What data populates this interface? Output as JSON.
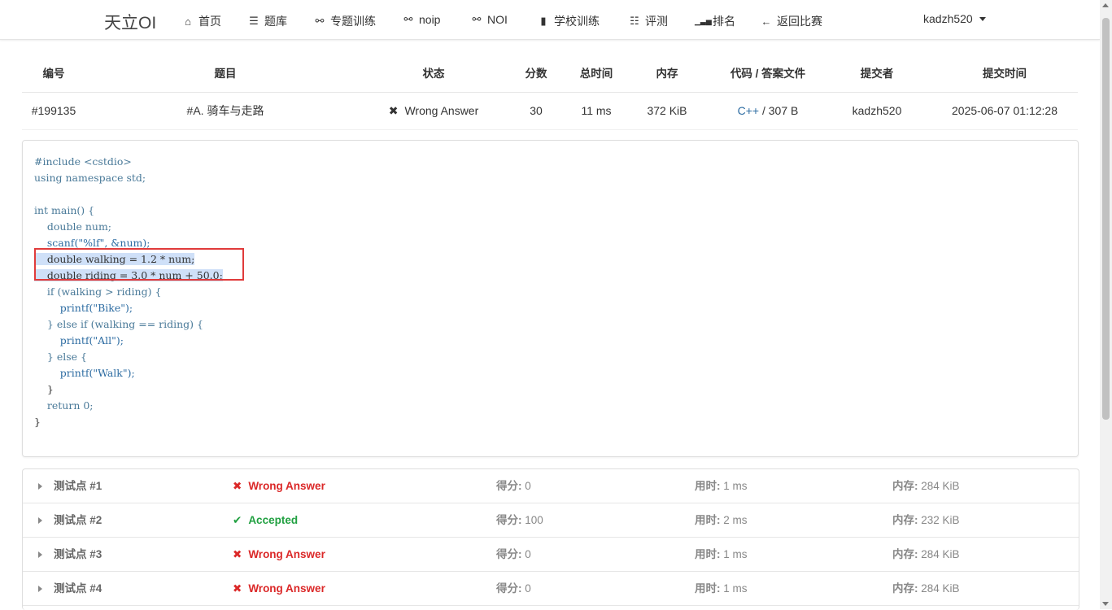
{
  "nav": {
    "brand": "天立OI",
    "items": [
      {
        "label": "首页",
        "icon": "home-icon",
        "glyph": "⌂"
      },
      {
        "label": "题库",
        "icon": "list-icon",
        "glyph": "☰"
      },
      {
        "label": "专题训练",
        "icon": "bicycle-icon",
        "glyph": "⚯"
      },
      {
        "label": "noip",
        "icon": "bicycle-icon",
        "glyph": "⚯"
      },
      {
        "label": "NOI",
        "icon": "bicycle-icon",
        "glyph": "⚯"
      },
      {
        "label": "学校训练",
        "icon": "building-icon",
        "glyph": "▮"
      },
      {
        "label": "评测",
        "icon": "tasks-icon",
        "glyph": "☷"
      },
      {
        "label": "排名",
        "icon": "signal-icon",
        "glyph": "▁▃▅"
      },
      {
        "label": "返回比赛",
        "icon": "arrow-left-icon",
        "glyph": "←"
      }
    ],
    "user": "kadzh520"
  },
  "summary": {
    "headers": [
      "编号",
      "题目",
      "状态",
      "分数",
      "总时间",
      "内存",
      "代码 / 答案文件",
      "提交者",
      "提交时间"
    ],
    "row": {
      "id": "#199135",
      "problem": "#A. 骑车与走路",
      "status": "Wrong Answer",
      "score": "30",
      "time": "11 ms",
      "memory": "372 KiB",
      "language": "C++",
      "code_size": "/ 307 B",
      "submitter": "kadzh520",
      "submit_time": "2025-06-07 01:12:28"
    }
  },
  "code_lines": [
    "#include <cstdio>",
    "using namespace std;",
    "",
    "int main() {",
    "    double num;",
    "    scanf(\"%lf\", &num);",
    "    double walking = 1.2 * num;",
    "    double riding = 3.0 * num + 50.0;",
    "    if (walking > riding) {",
    "        printf(\"Bike\");",
    "    } else if (walking == riding) {",
    "        printf(\"All\");",
    "    } else {",
    "        printf(\"Walk\");",
    "    }",
    "    return 0;",
    "}"
  ],
  "tests": {
    "score_label": "得分:",
    "time_label": "用时:",
    "memory_label": "内存:",
    "rows": [
      {
        "name": "测试点 #1",
        "status": "Wrong Answer",
        "score": "0",
        "time": "1 ms",
        "memory": "284 KiB"
      },
      {
        "name": "测试点 #2",
        "status": "Accepted",
        "score": "100",
        "time": "2 ms",
        "memory": "232 KiB"
      },
      {
        "name": "测试点 #3",
        "status": "Wrong Answer",
        "score": "0",
        "time": "1 ms",
        "memory": "284 KiB"
      },
      {
        "name": "测试点 #4",
        "status": "Wrong Answer",
        "score": "0",
        "time": "1 ms",
        "memory": "284 KiB"
      }
    ]
  },
  "colors": {
    "wrong": "#db2828",
    "accepted": "#21a041",
    "link": "#2d6ca2",
    "highlight_box": "#e03b3b"
  }
}
